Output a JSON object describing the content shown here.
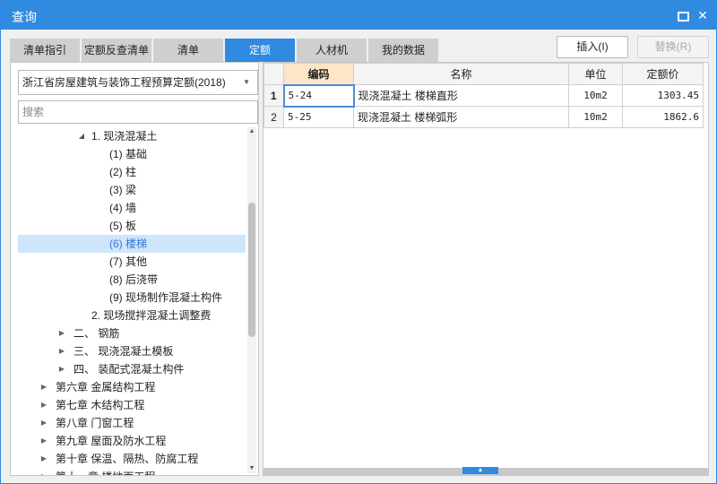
{
  "window": {
    "title": "查询"
  },
  "tabs": [
    {
      "label": "清单指引"
    },
    {
      "label": "定额反查清单"
    },
    {
      "label": "清单"
    },
    {
      "label": "定额"
    },
    {
      "label": "人材机"
    },
    {
      "label": "我的数据"
    }
  ],
  "active_tab": "定额",
  "buttons": {
    "insert": "插入(I)",
    "replace": "替换(R)"
  },
  "library_select": {
    "value": "浙江省房屋建筑与装饰工程预算定额(2018)"
  },
  "search": {
    "placeholder": "搜索"
  },
  "tree": [
    {
      "label": "1. 现浇混凝土",
      "expanded": true
    },
    {
      "label": "(1) 基础"
    },
    {
      "label": "(2) 柱"
    },
    {
      "label": "(3) 梁"
    },
    {
      "label": "(4) 墙"
    },
    {
      "label": "(5) 板"
    },
    {
      "label": "(6) 楼梯",
      "selected": true
    },
    {
      "label": "(7) 其他"
    },
    {
      "label": "(8) 后浇带"
    },
    {
      "label": "(9) 现场制作混凝土构件"
    },
    {
      "label": "2. 现场搅拌混凝土调整费"
    },
    {
      "label": "二、 钢筋"
    },
    {
      "label": "三、 现浇混凝土模板"
    },
    {
      "label": "四、 装配式混凝土构件"
    },
    {
      "label": "第六章 金属结构工程"
    },
    {
      "label": "第七章 木结构工程"
    },
    {
      "label": "第八章 门窗工程"
    },
    {
      "label": "第九章 屋面及防水工程"
    },
    {
      "label": "第十章 保温、隔热、防腐工程"
    },
    {
      "label": "第十一章 楼地面工程"
    }
  ],
  "table": {
    "headers": {
      "code": "编码",
      "name": "名称",
      "unit": "单位",
      "price": "定额价"
    },
    "rows": [
      {
        "no": "1",
        "code": "5-24",
        "name": "现浇混凝土 楼梯直形",
        "unit": "10m2",
        "price": "1303.45"
      },
      {
        "no": "2",
        "code": "5-25",
        "name": "现浇混凝土 楼梯弧形",
        "unit": "10m2",
        "price": "1862.6"
      }
    ]
  }
}
